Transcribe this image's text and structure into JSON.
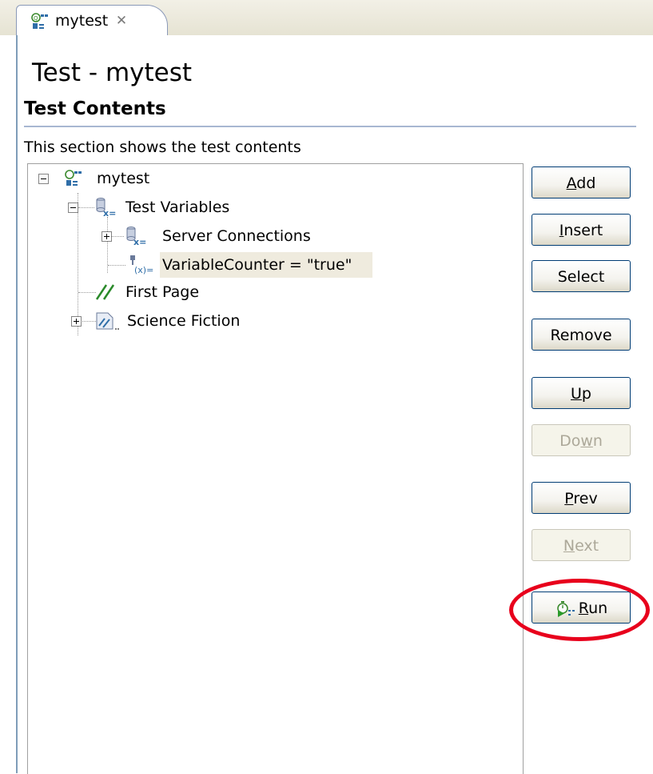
{
  "tab": {
    "label": "mytest",
    "close": "✕",
    "icon": "test-suite-icon"
  },
  "page_title": "Test - mytest",
  "section": {
    "title": "Test Contents",
    "description": "This section shows the test contents"
  },
  "tree": {
    "root": {
      "label": "mytest",
      "icon": "test-suite-icon",
      "expanded": true
    },
    "test_variables": {
      "label": "Test Variables",
      "icon": "database-variable-icon",
      "expanded": true
    },
    "server_connections": {
      "label": "Server Connections",
      "icon": "database-variable-icon",
      "expanded": false
    },
    "variable_counter": {
      "label": "VariableCounter = \"true\"",
      "icon": "variable-assign-icon",
      "selected": true
    },
    "first_page": {
      "label": "First Page",
      "icon": "page-slash-icon"
    },
    "science_fiction": {
      "label": "Science Fiction",
      "icon": "page-graph-icon",
      "expanded": false
    }
  },
  "buttons": {
    "add": {
      "label": "Add",
      "mnemonic": "A",
      "rest": "dd",
      "enabled": true
    },
    "insert": {
      "label": "Insert",
      "mnemonic": "I",
      "rest": "nsert",
      "enabled": true
    },
    "select": {
      "label": "Select",
      "enabled": true
    },
    "remove": {
      "label": "Remove",
      "enabled": true
    },
    "up": {
      "label": "Up",
      "mnemonic": "U",
      "rest": "p",
      "enabled": true
    },
    "down": {
      "label": "Down",
      "pre": "Do",
      "mnemonic": "w",
      "rest": "n",
      "enabled": false
    },
    "prev": {
      "label": "Prev",
      "mnemonic": "P",
      "rest": "rev",
      "enabled": true
    },
    "next": {
      "label": "Next",
      "mnemonic": "N",
      "rest": "ext",
      "enabled": false
    },
    "run": {
      "label": "Run",
      "mnemonic": "R",
      "rest": "un",
      "enabled": true,
      "icon": "run-test-icon"
    }
  },
  "colors": {
    "highlight": "#e8001c",
    "selection": "#efebde",
    "button_border": "#003c74"
  }
}
